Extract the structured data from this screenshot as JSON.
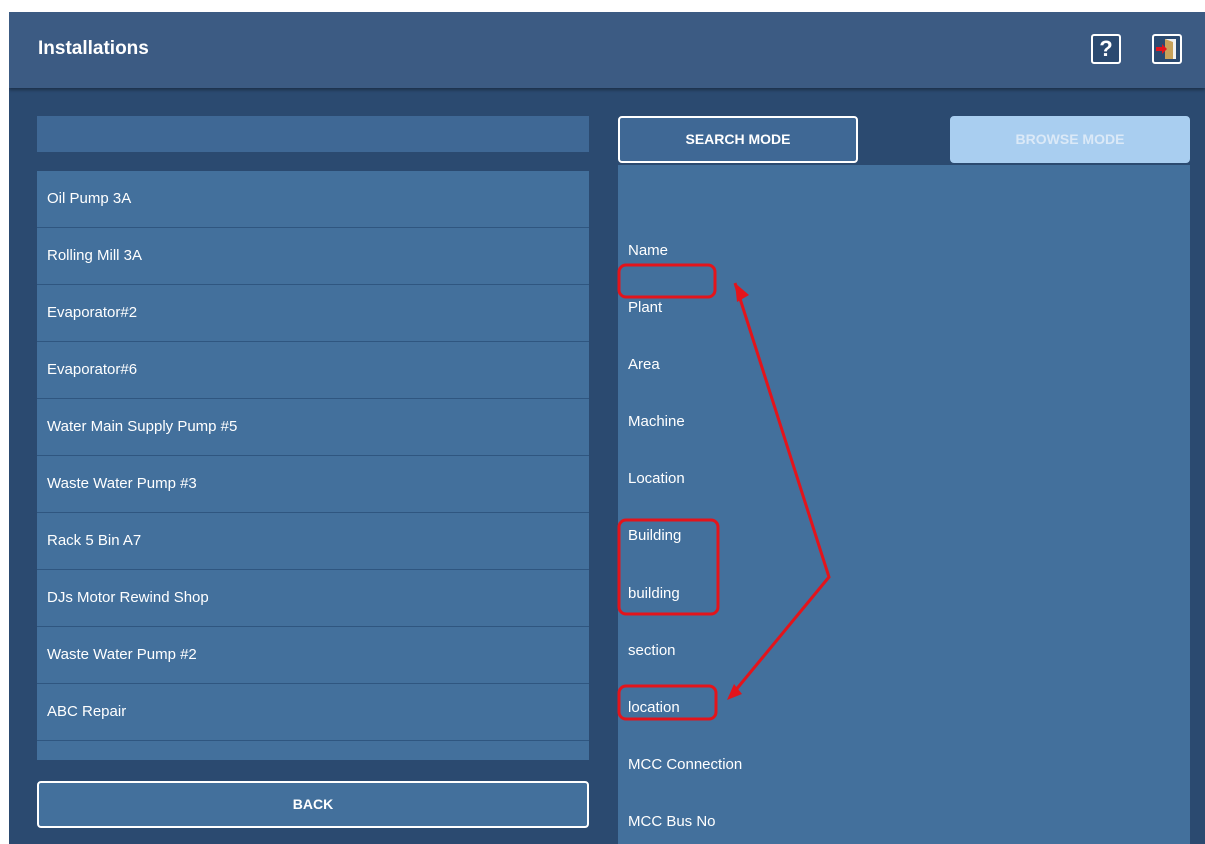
{
  "header": {
    "title": "Installations",
    "help_label": "?",
    "help_icon": "question-mark-icon",
    "exit_icon": "exit-door-icon"
  },
  "search": {
    "value": "",
    "placeholder": ""
  },
  "installations": [
    "Oil Pump 3A",
    "Rolling Mill 3A",
    "Evaporator#2",
    "Evaporator#6",
    "Water Main Supply Pump #5",
    "Waste Water Pump #3",
    "Rack 5  Bin A7",
    "DJs Motor Rewind Shop",
    "Waste Water Pump #2",
    "ABC Repair"
  ],
  "buttons": {
    "back": "BACK",
    "search_mode": "SEARCH MODE",
    "browse_mode": "BROWSE MODE"
  },
  "fields": [
    "Name",
    "Plant",
    "Area",
    "Machine",
    "Location",
    "Building",
    "building",
    "section",
    "location",
    "MCC Connection",
    "MCC Bus No"
  ],
  "colors": {
    "background": "#2b4a70",
    "header": "#3c5b83",
    "panel": "#43709c",
    "annotation": "#e3141b",
    "browse_mode_disabled": "#a9cef0"
  }
}
